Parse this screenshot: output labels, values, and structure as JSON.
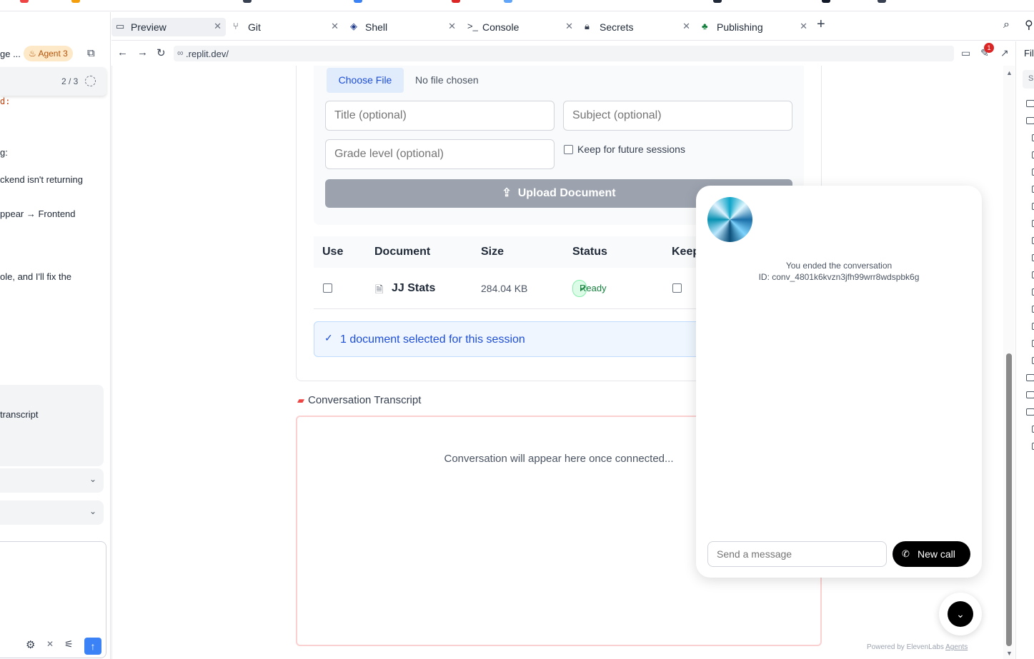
{
  "left_panel": {
    "title": "ge ...",
    "agent_badge": "Agent 3",
    "pager": "2 / 3",
    "text_lines": [
      "d:",
      "g:",
      "ckend isn't returning",
      "ppear → Frontend",
      "ole, and I'll fix the",
      "transcript"
    ]
  },
  "tabs": [
    {
      "label": "Preview",
      "icon": "monitor-icon",
      "active": true
    },
    {
      "label": "Git",
      "icon": "git-branch-icon"
    },
    {
      "label": "Shell",
      "icon": "shell-icon"
    },
    {
      "label": "Console",
      "icon": "terminal-icon"
    },
    {
      "label": "Secrets",
      "icon": "lock-icon"
    },
    {
      "label": "Publishing",
      "icon": "publish-icon"
    }
  ],
  "url_bar": {
    "url": ".replit.dev/",
    "notification_count": "1"
  },
  "upload": {
    "choose_file": "Choose File",
    "no_file": "No file chosen",
    "title_placeholder": "Title (optional)",
    "subject_placeholder": "Subject (optional)",
    "grade_placeholder": "Grade level (optional)",
    "keep_label": "Keep for future sessions",
    "upload_button": "Upload Document"
  },
  "table": {
    "headers": [
      "Use",
      "Document",
      "Size",
      "Status",
      "Keep"
    ],
    "rows": [
      {
        "document": "JJ Stats",
        "size": "284.04 KB",
        "status": "Ready"
      }
    ]
  },
  "selection_notice": "1 document selected for this session",
  "transcript": {
    "title": "Conversation Transcript",
    "placeholder": "Conversation will appear here once connected..."
  },
  "widget": {
    "ended_text": "You ended the conversation",
    "conversation_id": "ID: conv_4801k6kvzn3jfh99wrr8wdspbk6g",
    "message_placeholder": "Send a message",
    "new_call": "New call",
    "powered_by": "Powered by ElevenLabs",
    "powered_link": "Agents"
  },
  "right_panel": {
    "title": "Fil",
    "search": "S"
  },
  "colors": {
    "accent_blue": "#1d4ed8",
    "ready_green": "#15803d",
    "upload_disabled": "#9ca3af",
    "agent_badge": "#b45309"
  }
}
